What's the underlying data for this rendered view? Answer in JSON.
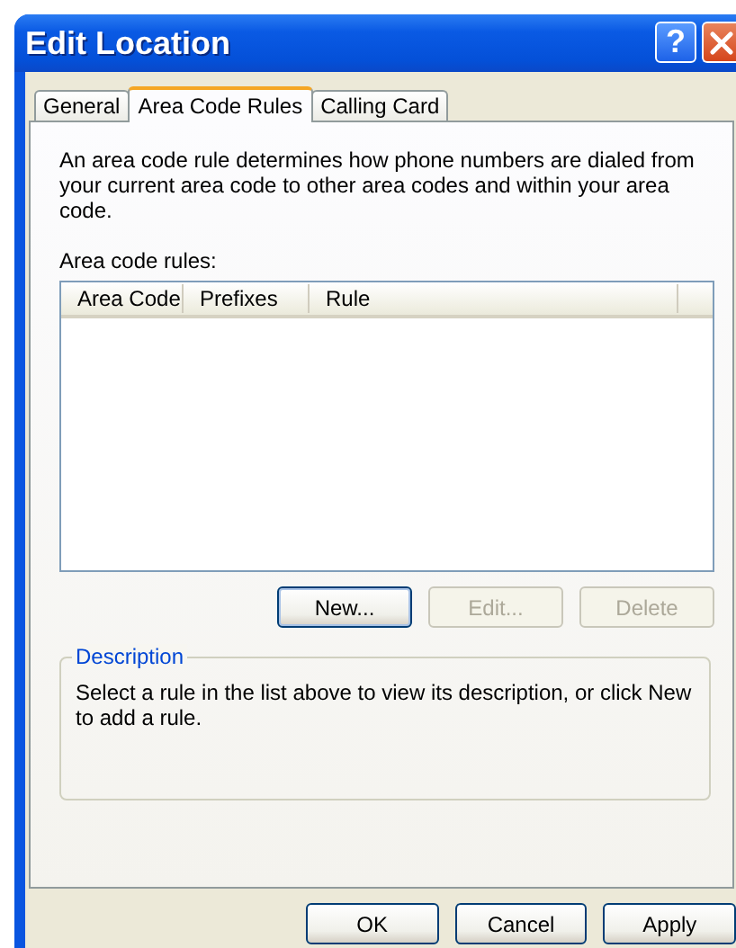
{
  "window": {
    "title": "Edit Location"
  },
  "title_buttons": [
    {
      "kind": "help",
      "label": "?"
    },
    {
      "kind": "close"
    }
  ],
  "tabs": [
    {
      "label": "General",
      "selected": false
    },
    {
      "label": "Area Code Rules",
      "selected": true
    },
    {
      "label": "Calling Card",
      "selected": false
    }
  ],
  "intro": "An area code rule determines how phone numbers are dialed from your current area code to other area codes and within your area code.",
  "list_label": "Area code rules:",
  "table": {
    "columns": [
      "Area Code",
      "Prefixes",
      "Rule"
    ]
  },
  "list_buttons": [
    {
      "label": "New...",
      "disabled": false,
      "focused": true
    },
    {
      "label": "Edit...",
      "disabled": true,
      "focused": false
    },
    {
      "label": "Delete",
      "disabled": true,
      "focused": false
    }
  ],
  "description": {
    "title": "Description",
    "text": "Select a rule in the list above to view its description, or click New to add a rule."
  },
  "dialog_buttons": [
    {
      "label": "OK"
    },
    {
      "label": "Cancel"
    },
    {
      "label": "Apply"
    }
  ]
}
